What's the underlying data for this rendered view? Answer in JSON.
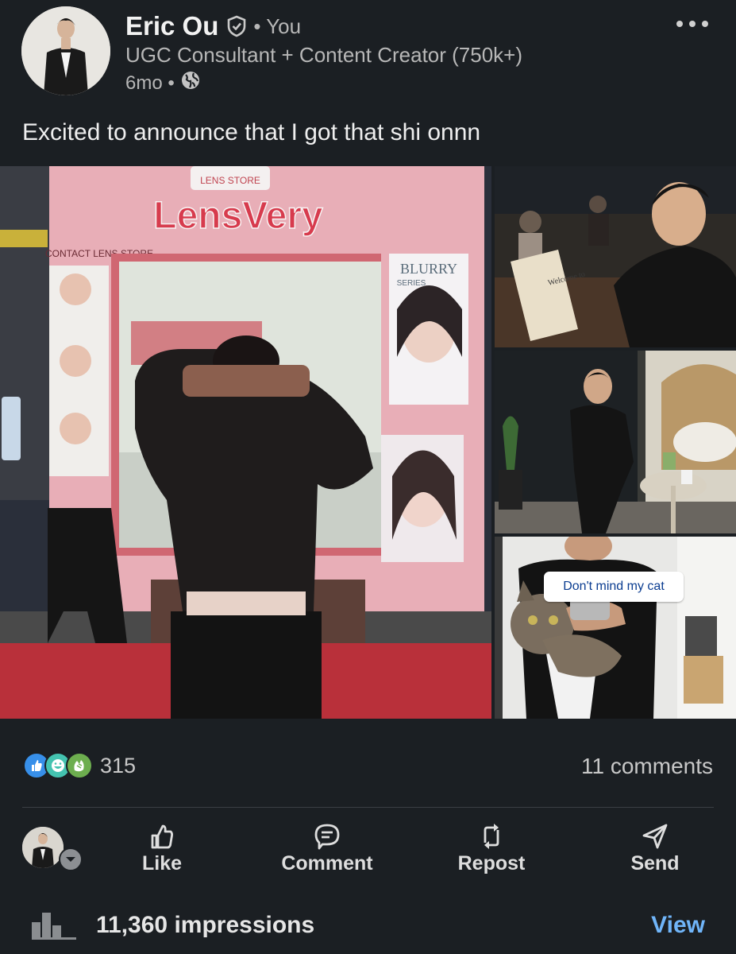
{
  "author": {
    "name": "Eric Ou",
    "relation": "• You",
    "headline": "UGC Consultant + Content Creator (750k+)",
    "time": "6mo •"
  },
  "post": {
    "text": "Excited to announce that I got that shi onnn",
    "images": {
      "main": {
        "store_name": "LensVery",
        "store_badge": "LENS STORE",
        "store_subtitle": "CONTACT LENS STORE",
        "poster_title": "BLURRY",
        "poster_subtitle": "SERIES"
      },
      "thumb1": {
        "book_text": "Welcome to"
      },
      "thumb3": {
        "caption": "Don't mind my cat"
      }
    }
  },
  "social": {
    "reaction_icons": [
      "like-reaction-icon",
      "funny-reaction-icon",
      "celebrate-reaction-icon"
    ],
    "reaction_count": "315",
    "comments": "11 comments"
  },
  "actions": [
    {
      "icon": "thumbs-up-icon",
      "label": "Like"
    },
    {
      "icon": "comment-icon",
      "label": "Comment"
    },
    {
      "icon": "repost-icon",
      "label": "Repost"
    },
    {
      "icon": "send-icon",
      "label": "Send"
    }
  ],
  "impressions": {
    "text": "11,360 impressions",
    "link": "View"
  },
  "colors": {
    "background": "#1b1f23",
    "link": "#70b5f9",
    "store_pink": "#e8aeb7"
  }
}
